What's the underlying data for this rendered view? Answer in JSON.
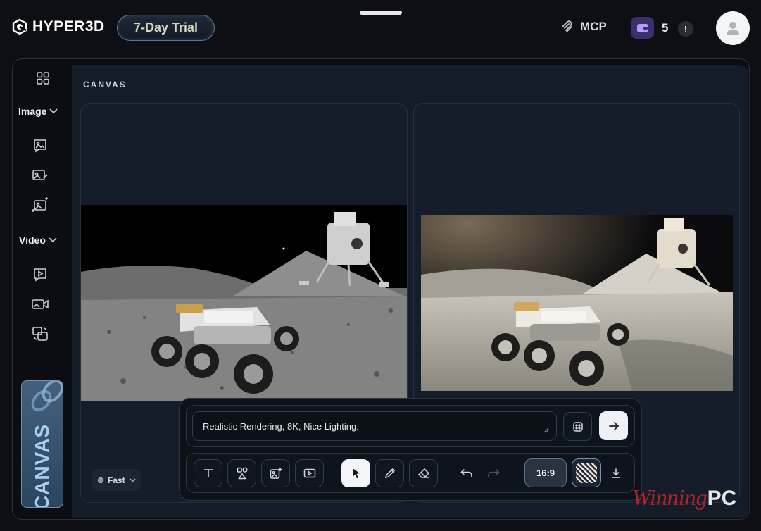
{
  "app": {
    "name": "HYPER3D",
    "trial_badge": "7-Day Trial"
  },
  "header": {
    "mcp_label": "MCP",
    "credits": "5",
    "alert_symbol": "!"
  },
  "sidebar": {
    "image_group_label": "Image",
    "video_group_label": "Video",
    "brand_label": "CANVAS",
    "icons": [
      "grid-icon",
      "image-icon",
      "image-edit-icon",
      "image-generate-icon",
      "video-play-icon",
      "video-camera-icon",
      "video-convert-icon"
    ]
  },
  "main": {
    "section_title": "CANVAS",
    "speed_mode": "Fast"
  },
  "prompt": {
    "text": "Realistic Rendering, 8K, Nice Lighting."
  },
  "toolbar": {
    "tools": [
      "text-tool",
      "shapes-tool",
      "add-image-tool",
      "add-video-tool",
      "select-tool",
      "pencil-tool",
      "eraser-tool"
    ],
    "active_tool": "select-tool",
    "aspect_ratio": "16:9"
  },
  "watermark": {
    "script": "Winning",
    "suffix": "PC"
  },
  "colors": {
    "background": "#0d0f14",
    "panel": "#141d29",
    "trial_text": "#cfd9b8",
    "brand_tile": "#44607e",
    "wallet": "#3b2f6e",
    "watermark_red": "#b0222a"
  }
}
